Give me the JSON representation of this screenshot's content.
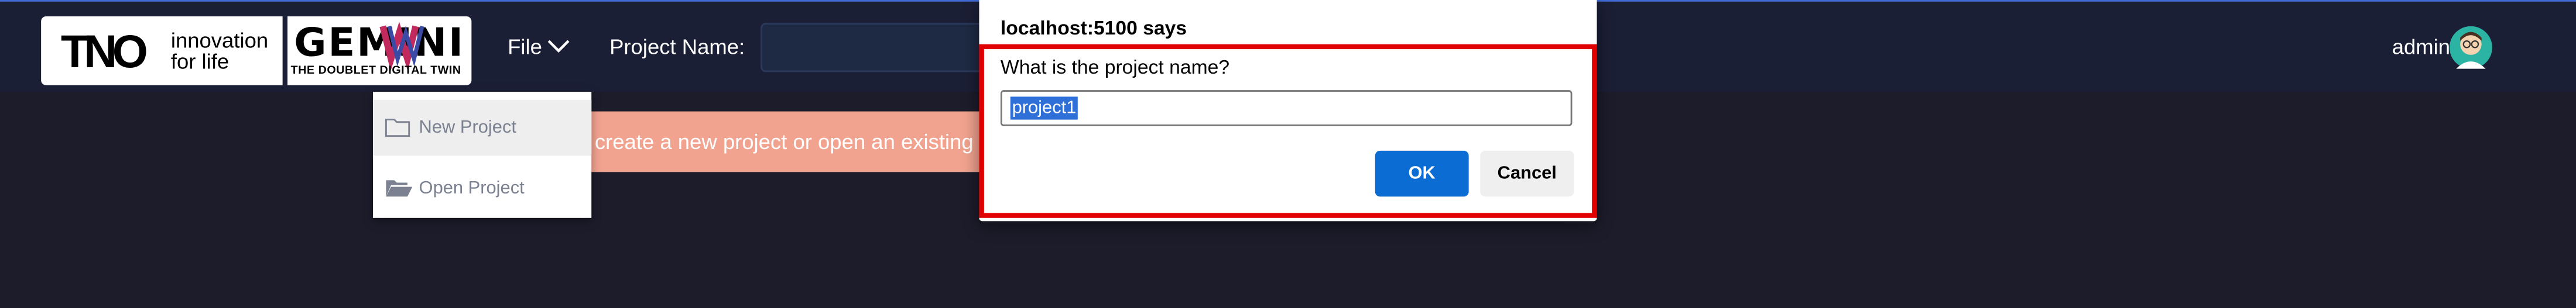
{
  "header": {
    "logo_tno": "TNO",
    "logo_tagline": "innovation for life",
    "logo_gemini": "GEMINI",
    "logo_gemini_sub": "THE DOUBLET DIGITAL TWIN",
    "file_menu_label": "File",
    "project_name_label": "Project Name:",
    "project_name_value": "",
    "user_name": "admin",
    "avatar_icon": "user-avatar-icon"
  },
  "file_dropdown": {
    "items": [
      {
        "label": "New Project",
        "icon": "folder-icon",
        "hovered": true
      },
      {
        "label": "Open Project",
        "icon": "folder-open-icon",
        "hovered": false
      }
    ]
  },
  "banner": {
    "text": "create a new project or open an existing proj"
  },
  "dialog": {
    "title": "localhost:5100 says",
    "prompt": "What is the project name?",
    "input_value": "project1",
    "ok_label": "OK",
    "cancel_label": "Cancel"
  },
  "colors": {
    "background": "#1c1c2b",
    "topbar": "#1b1f36",
    "banner": "#f1a38f",
    "ok_button": "#0b6cd4",
    "highlight_frame": "#e00000",
    "selection": "#2e6fd8"
  }
}
